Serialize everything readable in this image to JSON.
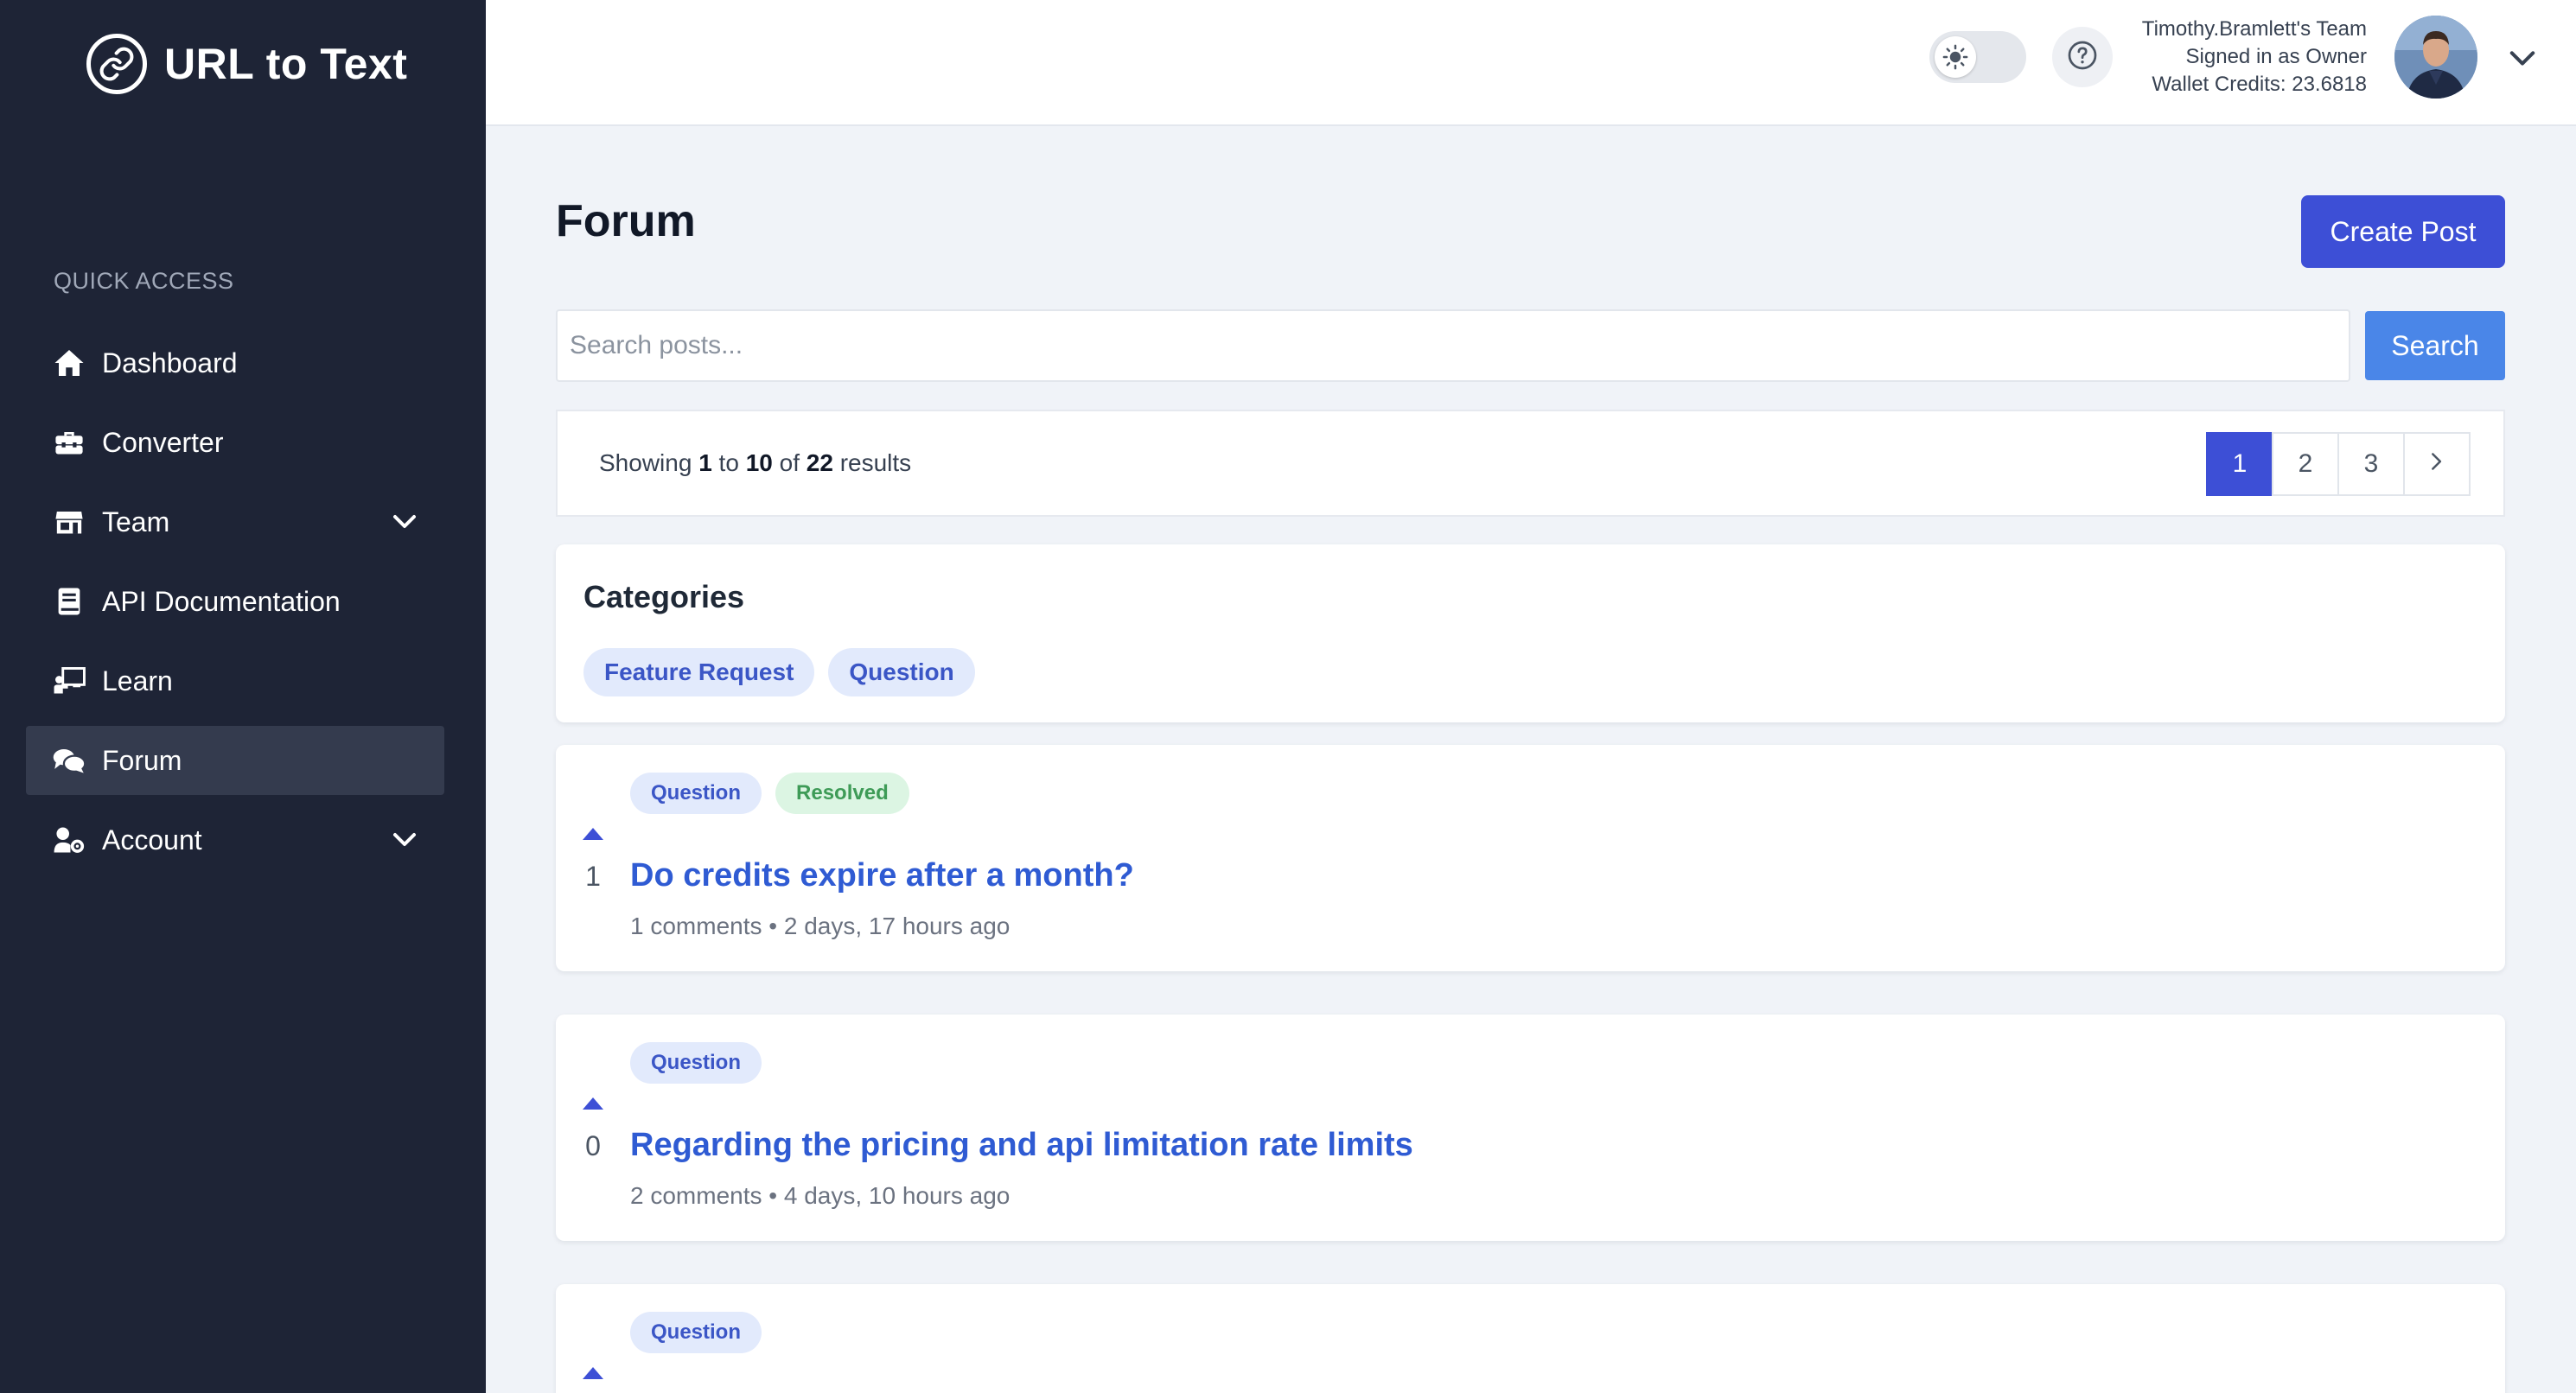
{
  "app": {
    "name": "URL to Text"
  },
  "sidebar": {
    "section_label": "QUICK ACCESS",
    "items": [
      {
        "label": "Dashboard",
        "icon": "home-icon",
        "active": false,
        "expandable": false
      },
      {
        "label": "Converter",
        "icon": "toolbox-icon",
        "active": false,
        "expandable": false
      },
      {
        "label": "Team",
        "icon": "store-icon",
        "active": false,
        "expandable": true
      },
      {
        "label": "API Documentation",
        "icon": "book-icon",
        "active": false,
        "expandable": false
      },
      {
        "label": "Learn",
        "icon": "chalkboard-teacher-icon",
        "active": false,
        "expandable": false
      },
      {
        "label": "Forum",
        "icon": "comments-icon",
        "active": true,
        "expandable": false
      },
      {
        "label": "Account",
        "icon": "user-cog-icon",
        "active": false,
        "expandable": true
      }
    ]
  },
  "header": {
    "team_name": "Timothy.Bramlett's Team",
    "role_line": "Signed in as Owner",
    "credits_line": "Wallet Credits: 23.6818",
    "theme_toggle_icon": "sun-icon",
    "help_icon": "question-circle-icon"
  },
  "main": {
    "title": "Forum",
    "create_post_label": "Create Post",
    "search": {
      "placeholder": "Search posts...",
      "value": "",
      "button_label": "Search"
    },
    "pagination": {
      "showing_prefix": "Showing",
      "from": "1",
      "to_word": "to",
      "to": "10",
      "of_word": "of",
      "total": "22",
      "suffix": "results",
      "pages": [
        "1",
        "2",
        "3"
      ],
      "current_page": "1"
    },
    "categories": {
      "title": "Categories",
      "tags": [
        "Feature Request",
        "Question"
      ]
    },
    "posts": [
      {
        "votes": "1",
        "title": "Do credits expire after a month?",
        "meta": "1 comments • 2 days, 17 hours ago",
        "badges": [
          {
            "label": "Question",
            "kind": "category"
          },
          {
            "label": "Resolved",
            "kind": "status"
          }
        ]
      },
      {
        "votes": "0",
        "title": "Regarding the pricing and api limitation rate limits",
        "meta": "2 comments • 4 days, 10 hours ago",
        "badges": [
          {
            "label": "Question",
            "kind": "category"
          }
        ]
      },
      {
        "votes": "",
        "title": "",
        "meta": "",
        "badges": [
          {
            "label": "Question",
            "kind": "category"
          }
        ]
      }
    ]
  },
  "colors": {
    "sidebar_bg": "#1e2436",
    "primary": "#3d4fd6",
    "search_button": "#4a86e8",
    "link": "#2f5bd3",
    "tag_bg": "#e2eafc",
    "resolved_bg": "#dcf5e3",
    "resolved_text": "#3e9b57"
  }
}
